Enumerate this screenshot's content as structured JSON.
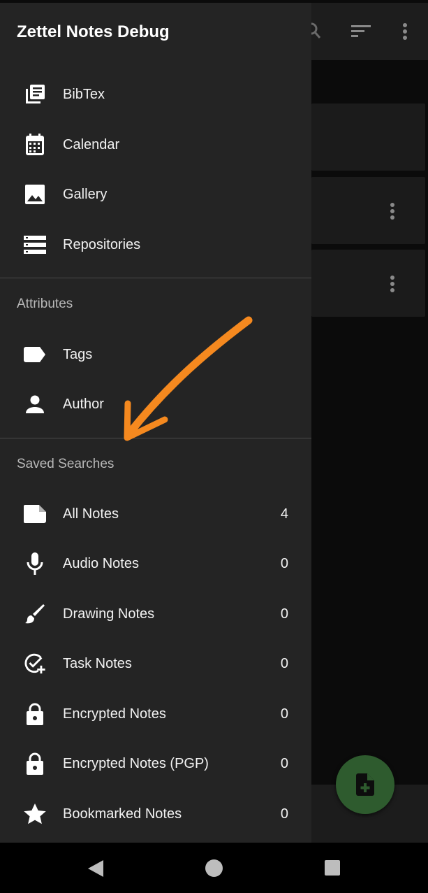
{
  "drawer": {
    "title": "Zettel Notes Debug",
    "main_items": [
      {
        "label": "BibTex",
        "icon": "library-books-icon"
      },
      {
        "label": "Calendar",
        "icon": "calendar-icon"
      },
      {
        "label": "Gallery",
        "icon": "image-icon"
      },
      {
        "label": "Repositories",
        "icon": "storage-icon"
      }
    ],
    "attributes_header": "Attributes",
    "attribute_items": [
      {
        "label": "Tags",
        "icon": "label-icon"
      },
      {
        "label": "Author",
        "icon": "person-icon"
      }
    ],
    "saved_searches_header": "Saved Searches",
    "saved_searches": [
      {
        "label": "All Notes",
        "count": "4",
        "icon": "note-icon"
      },
      {
        "label": "Audio Notes",
        "count": "0",
        "icon": "microphone-icon"
      },
      {
        "label": "Drawing Notes",
        "count": "0",
        "icon": "brush-icon"
      },
      {
        "label": "Task Notes",
        "count": "0",
        "icon": "task-add-icon"
      },
      {
        "label": "Encrypted Notes",
        "count": "0",
        "icon": "lock-icon"
      },
      {
        "label": "Encrypted Notes (PGP)",
        "count": "0",
        "icon": "lock-icon"
      },
      {
        "label": "Bookmarked Notes",
        "count": "0",
        "icon": "star-icon"
      }
    ]
  },
  "colors": {
    "drawer_bg": "#242424",
    "fab_bg": "#2e5b2e",
    "annotation_arrow": "#f5891f"
  }
}
